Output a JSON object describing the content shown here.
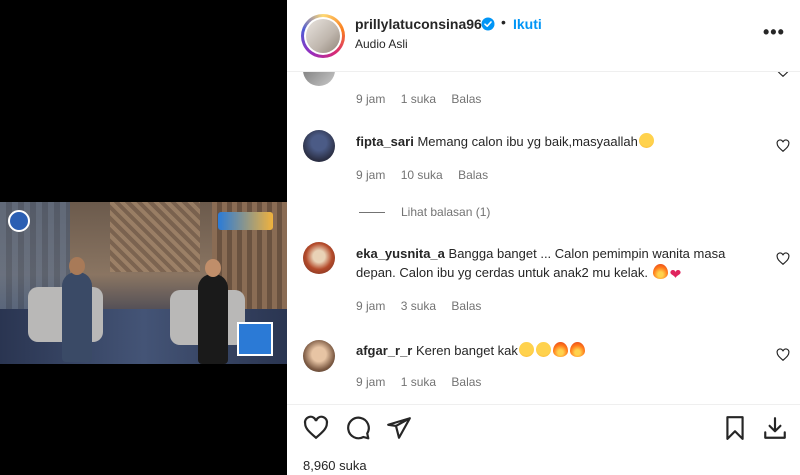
{
  "header": {
    "username": "prillylatuconsina96",
    "separator": "•",
    "follow_label": "Ikuti",
    "subtitle": "Audio Asli",
    "more_label": "•••"
  },
  "comments": [
    {
      "user": "",
      "text": "",
      "time": "9 jam",
      "likes": "1 suka",
      "reply": "Balas"
    },
    {
      "user": "fipta_sari",
      "text": "Memang calon ibu yg baik,masyaallah",
      "time": "9 jam",
      "likes": "10 suka",
      "reply": "Balas",
      "emojis": [
        "heart-eyes"
      ]
    },
    {
      "user": "eka_yusnita_a",
      "text": "Bangga banget ... Calon pemimpin wanita masa depan. Calon ibu yg cerdas untuk anak2 mu kelak.",
      "time": "9 jam",
      "likes": "3 suka",
      "reply": "Balas",
      "emojis": [
        "fire",
        "red-heart"
      ]
    },
    {
      "user": "afgar_r_r",
      "text": "Keren banget kak",
      "time": "9 jam",
      "likes": "1 suka",
      "reply": "Balas",
      "emojis": [
        "heart-eyes",
        "heart-eyes",
        "fire",
        "fire"
      ]
    }
  ],
  "view_replies_label": "Lihat balasan (1)",
  "likes_count": "8,960 suka",
  "icons": [
    "heart-icon",
    "comment-icon",
    "share-icon",
    "bookmark-icon",
    "download-icon",
    "verified-icon",
    "more-icon"
  ],
  "colors": {
    "accent": "#0095f6",
    "text": "#262626",
    "muted": "#737373"
  }
}
